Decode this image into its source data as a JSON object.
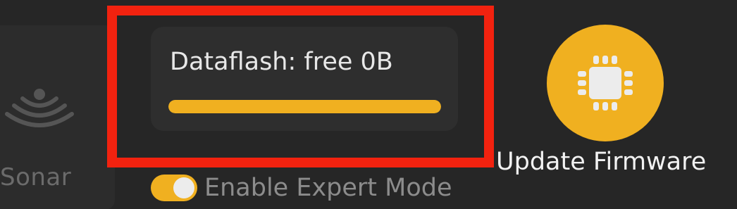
{
  "sensors": {
    "sonar_label": "Sonar",
    "sonar_icon": "sonar-icon"
  },
  "dataflash": {
    "label": "Dataflash: free 0B",
    "used_fraction": 1.0,
    "bar_color": "#f0b020"
  },
  "expert_mode": {
    "label": "Enable Expert Mode",
    "enabled": true
  },
  "firmware": {
    "label": "Update Firmware",
    "icon": "chip-icon",
    "accent": "#f0b020"
  },
  "highlight": {
    "color": "#f2220f"
  }
}
